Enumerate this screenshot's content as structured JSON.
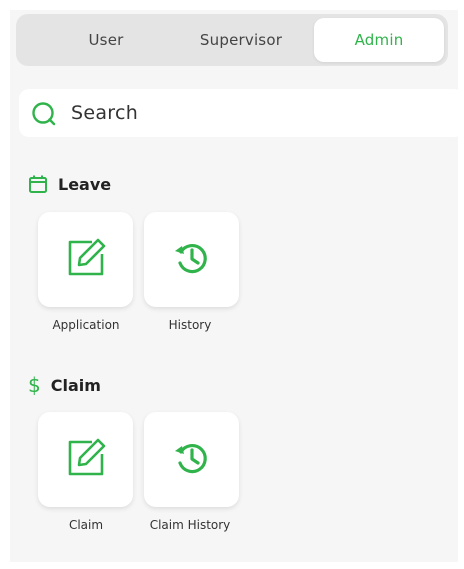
{
  "tabs": {
    "user": "User",
    "supervisor": "Supervisor",
    "admin": "Admin",
    "active": "Admin"
  },
  "search": {
    "placeholder": "Search"
  },
  "sections": {
    "leave": {
      "title": "Leave",
      "icon": "calendar-icon",
      "items": [
        {
          "label": "Application",
          "icon": "edit-icon"
        },
        {
          "label": "History",
          "icon": "history-icon"
        }
      ]
    },
    "claim": {
      "title": "Claim",
      "icon": "dollar-icon",
      "items": [
        {
          "label": "Claim",
          "icon": "edit-icon"
        },
        {
          "label": "Claim History",
          "icon": "history-icon"
        }
      ]
    }
  },
  "colors": {
    "accent": "#2fb34a",
    "panel": "#f6f6f6",
    "segment_bg": "#e4e4e4"
  }
}
